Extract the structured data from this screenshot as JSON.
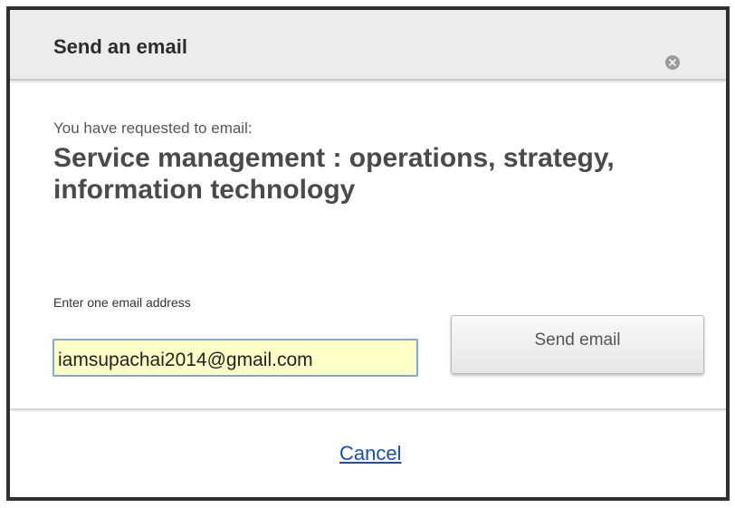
{
  "dialog": {
    "title": "Send an email",
    "close_icon": "close-circle-icon",
    "requested_label": "You have requested to email:",
    "item_title": "Service management : operations, strategy, information technology",
    "email_label": "Enter one email address",
    "email_value": "iamsupachai2014@gmail.com",
    "send_label": "Send email",
    "cancel_label": "Cancel"
  },
  "colors": {
    "header_bg": "#ececec",
    "input_bg": "#ffffc8",
    "input_border": "#7ea8d8",
    "link": "#1a4fb0"
  }
}
